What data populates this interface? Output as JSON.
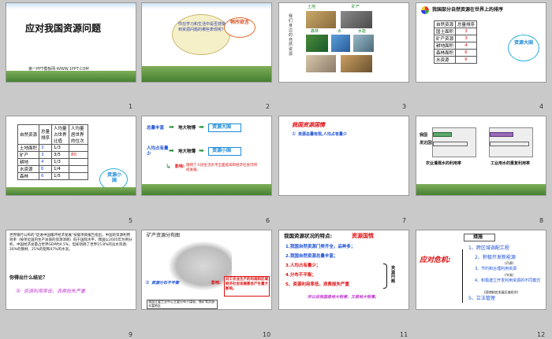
{
  "slides": [
    {
      "num": "1",
      "title": "应对我国资源问题",
      "subtitle": "第一PPT模板网-WWW.1PPT.COM"
    },
    {
      "num": "2",
      "bubble": "你在学习和生活中是否感受到资源问题的哪些表现呢？",
      "badge": "畅所欲言"
    },
    {
      "num": "3",
      "side": "我们身边的自然资源",
      "labels": [
        "土地",
        "矿产",
        "森林",
        "水",
        "水能"
      ]
    },
    {
      "num": "4",
      "title": "我国部分自然资源在世界上的排序",
      "headers": [
        "自然资源",
        "总量排序"
      ],
      "rows": [
        [
          "国土面积",
          "3"
        ],
        [
          "矿产资源",
          "3"
        ],
        [
          "耕地面积",
          "4"
        ],
        [
          "森林面积",
          "6"
        ],
        [
          "水资源",
          "6"
        ]
      ],
      "badge": "资源大国"
    },
    {
      "num": "5",
      "headers": [
        "自然资源",
        "总量排序",
        "人均量占世界比值",
        "人均量居世界的位次"
      ],
      "rows": [
        [
          "土地面积",
          "3",
          "1/3",
          ""
        ],
        [
          "矿产",
          "3",
          "3/5",
          "80"
        ],
        [
          "耕地",
          "4",
          "1/3",
          ""
        ],
        [
          "水资源",
          "6",
          "1/4",
          ""
        ],
        [
          "森林",
          "6",
          "1/5",
          ""
        ]
      ],
      "badge": "资源小国"
    },
    {
      "num": "6",
      "line1": "总量丰富",
      "mid1": "地大物博",
      "box1": "资源大国",
      "line2": "人均占有量少",
      "mid2": "地大物薄",
      "box2": "资源小国",
      "impact_label": "影响:",
      "impact": "阻碍了人民生活水平全面提高和经济社会可持续发展。"
    },
    {
      "num": "7",
      "title": "我国资源国情",
      "point": "资源总量有限,人均占有量少"
    },
    {
      "num": "8",
      "chart_left": "农业灌溉水的利用率",
      "chart_right": "工业用水的重复利用率",
      "labels": [
        "我国",
        "发达国家"
      ]
    },
    {
      "num": "9",
      "text": "世界银行公布的“促进中国循环经济发展”技援项目报告指出，中国的资源利用效率（按单位国内生产总值的资源消耗）低于国际水平。我国以2005年为例分析，中国经济总量占世界GDP约4.5%，但却消耗了世界15.8%的淡水资源、26%的钢材、25%的铝和47%的水泥。",
      "question": "你得出什么结论？",
      "answer": "资源利用率低，浪费损失严重"
    },
    {
      "num": "10",
      "title": "矿产资源分布图",
      "point": "资源分布不平衡",
      "impact_label": "影响:",
      "impact": "对工农业生产的布局和区域经济社会发展都会产生重大影响。",
      "note": "我国主要工业中心主要分布于煤炭、铁矿等资源丰富地区"
    },
    {
      "num": "11",
      "title": "我国资源状况的特点:",
      "highlight": "资源国情",
      "items": [
        "1.我国自然资源门类齐全，品种多；",
        "2.我国自然资源总量丰富；",
        "3.人均占有量少；",
        "4.分布不平衡；",
        "5、资源利用率低，浪费损失严重"
      ],
      "brace": "资源问题",
      "footer": "所以说我国是地大物博，又是地大物薄。"
    },
    {
      "num": "12",
      "title": "措施",
      "side": "应对危机:",
      "items": [
        "1、跨区域调配工程",
        "2、积极开发新能源",
        "(开源)",
        "3、节约和合理利用资源",
        "(节流)",
        "4、积极建立开发利用资源的不同模式",
        "(国地制宜发展区域经济)",
        "5、立法管理"
      ]
    }
  ]
}
